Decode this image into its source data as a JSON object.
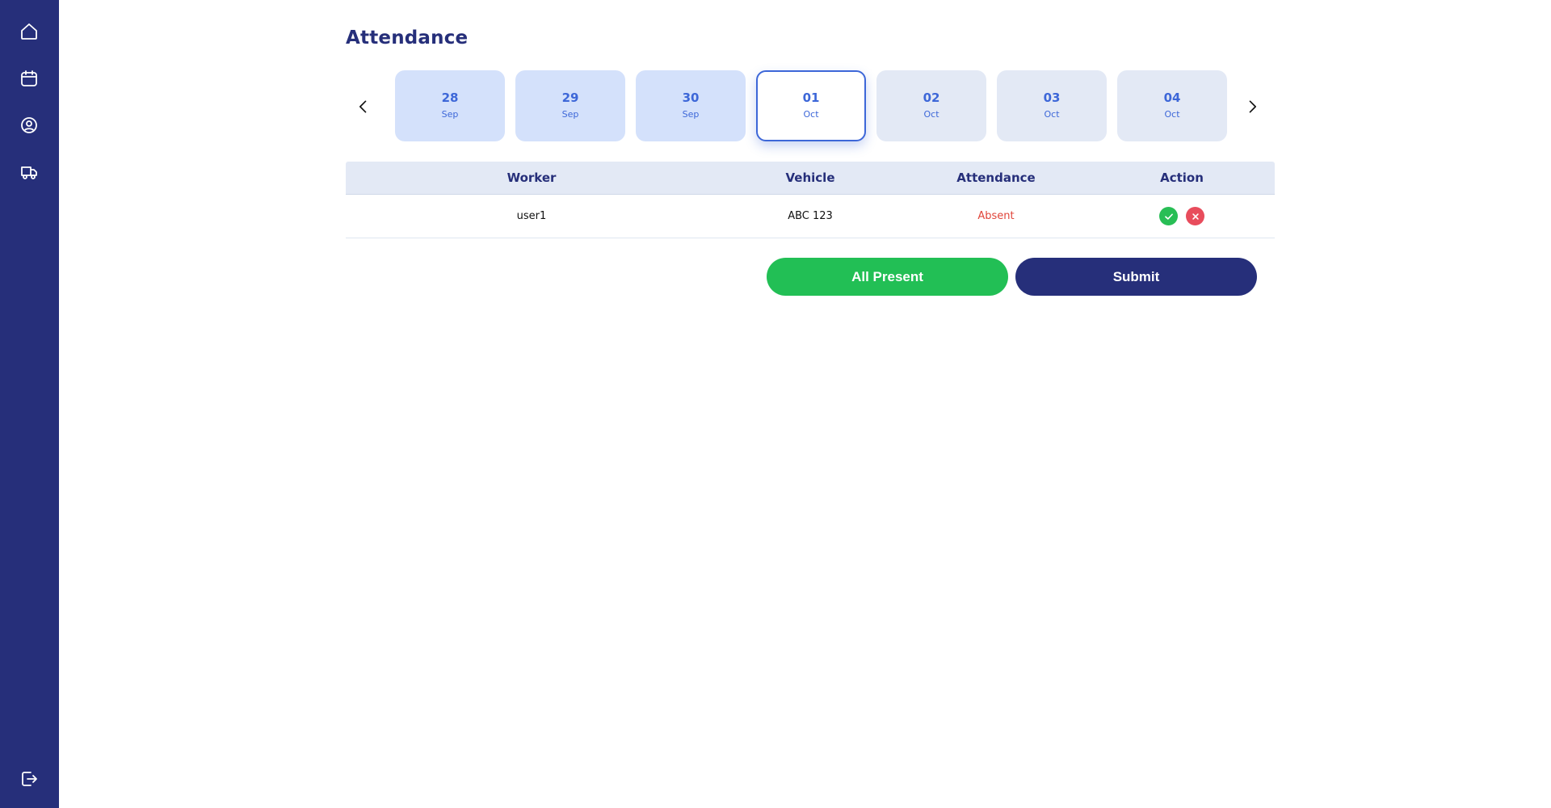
{
  "sidebar": {
    "items": [
      {
        "icon": "home-icon"
      },
      {
        "icon": "calendar-icon"
      },
      {
        "icon": "user-circle-icon"
      },
      {
        "icon": "truck-icon"
      }
    ],
    "logout_icon": "logout-icon",
    "background": "#262f7a"
  },
  "page": {
    "title": "Attendance"
  },
  "date_strip": {
    "days": [
      {
        "day": "28",
        "month": "Sep",
        "state": "past"
      },
      {
        "day": "29",
        "month": "Sep",
        "state": "past"
      },
      {
        "day": "30",
        "month": "Sep",
        "state": "past"
      },
      {
        "day": "01",
        "month": "Oct",
        "state": "selected"
      },
      {
        "day": "02",
        "month": "Oct",
        "state": "future"
      },
      {
        "day": "03",
        "month": "Oct",
        "state": "future"
      },
      {
        "day": "04",
        "month": "Oct",
        "state": "future"
      }
    ]
  },
  "table": {
    "headers": {
      "worker": "Worker",
      "vehicle": "Vehicle",
      "attendance": "Attendance",
      "action": "Action"
    },
    "rows": [
      {
        "worker": "user1",
        "vehicle": "ABC 123",
        "attendance": "Absent"
      }
    ]
  },
  "buttons": {
    "all_present": "All Present",
    "submit": "Submit"
  },
  "colors": {
    "primary": "#262f7a",
    "accent": "#3d67d8",
    "success": "#22bf55",
    "danger": "#e84c5c",
    "absent_text": "#e0453a"
  }
}
